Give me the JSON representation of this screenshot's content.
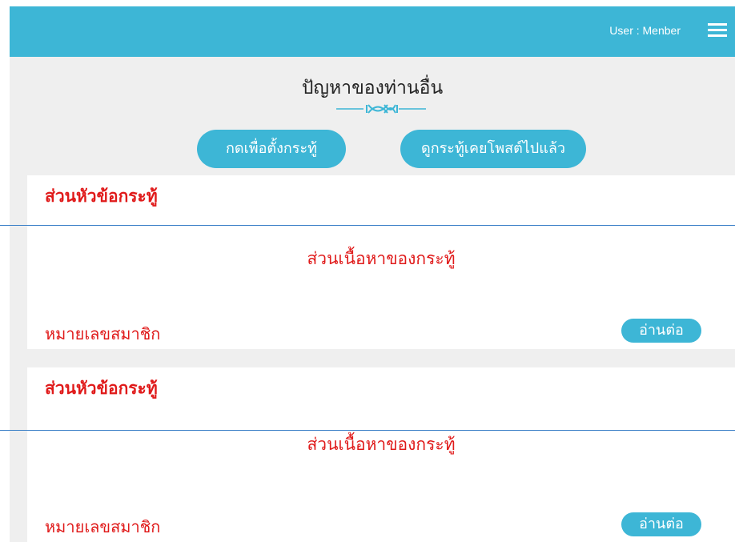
{
  "header": {
    "user_label": "User :  Menber",
    "menu_icon": "hamburger-menu-icon",
    "background_color": "#3db6d6"
  },
  "page": {
    "title": "ปัญหาของท่านอื่น",
    "ornament_icon": "dna-divider-icon"
  },
  "actions": {
    "create_post_label": "กดเพื่อตั้งกระทู้",
    "my_posts_label": "ดูกระทู้เคยโพสต์ไปแล้ว"
  },
  "posts": [
    {
      "title": "ส่วนหัวข้อกระทู้",
      "body": "ส่วนเนื้อหาของกระทู้",
      "member": "หมายเลขสมาชิก",
      "read_more": "อ่านต่อ"
    },
    {
      "title": "ส่วนหัวข้อกระทู้",
      "body": "ส่วนเนื้อหาของกระทู้",
      "member": "หมายเลขสมาชิก",
      "read_more": "อ่านต่อ"
    }
  ],
  "colors": {
    "accent": "#3db6d6",
    "post_text": "#e01a1a",
    "divider": "#3a7fc7"
  }
}
